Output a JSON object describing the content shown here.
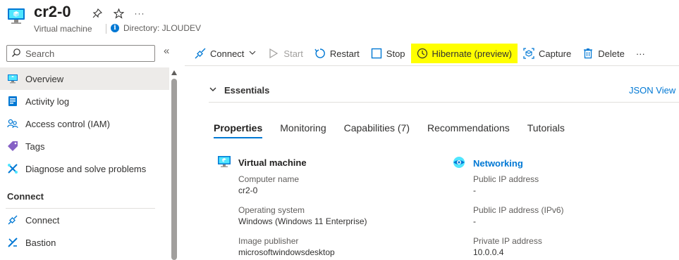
{
  "header": {
    "title": "cr2-0",
    "subtitle": "Virtual machine",
    "directory": "Directory: JLOUDEV",
    "icons": [
      "virtual-machine-icon",
      "pin-icon",
      "star-icon",
      "more-icon"
    ]
  },
  "sidebar": {
    "search_placeholder": "Search",
    "items": [
      {
        "label": "Overview",
        "icon": "vm-monitor-icon",
        "active": true
      },
      {
        "label": "Activity log",
        "icon": "activity-log-icon"
      },
      {
        "label": "Access control (IAM)",
        "icon": "people-icon"
      },
      {
        "label": "Tags",
        "icon": "tag-icon"
      },
      {
        "label": "Diagnose and solve problems",
        "icon": "wrench-icon"
      }
    ],
    "section_connect": "Connect",
    "connect_items": [
      {
        "label": "Connect",
        "icon": "plug-icon"
      },
      {
        "label": "Bastion",
        "icon": "bastion-icon"
      }
    ]
  },
  "toolbar": {
    "connect": "Connect",
    "start": "Start",
    "restart": "Restart",
    "stop": "Stop",
    "hibernate": "Hibernate (preview)",
    "capture": "Capture",
    "delete": "Delete",
    "more": "···"
  },
  "essentials": {
    "label": "Essentials",
    "json_view": "JSON View"
  },
  "tabs": [
    "Properties",
    "Monitoring",
    "Capabilities (7)",
    "Recommendations",
    "Tutorials"
  ],
  "properties": {
    "vm_header": "Virtual machine",
    "networking_header": "Networking",
    "left": [
      {
        "label": "Computer name",
        "value": "cr2-0"
      },
      {
        "label": "Operating system",
        "value": "Windows (Windows 11 Enterprise)"
      },
      {
        "label": "Image publisher",
        "value": "microsoftwindowsdesktop"
      }
    ],
    "right": [
      {
        "label": "Public IP address",
        "value": "-"
      },
      {
        "label": "Public IP address (IPv6)",
        "value": "-"
      },
      {
        "label": "Private IP address",
        "value": "10.0.0.4"
      }
    ]
  },
  "colors": {
    "accent": "#0078d4",
    "highlight": "#ffff00",
    "active_nav": "#edebe9"
  }
}
